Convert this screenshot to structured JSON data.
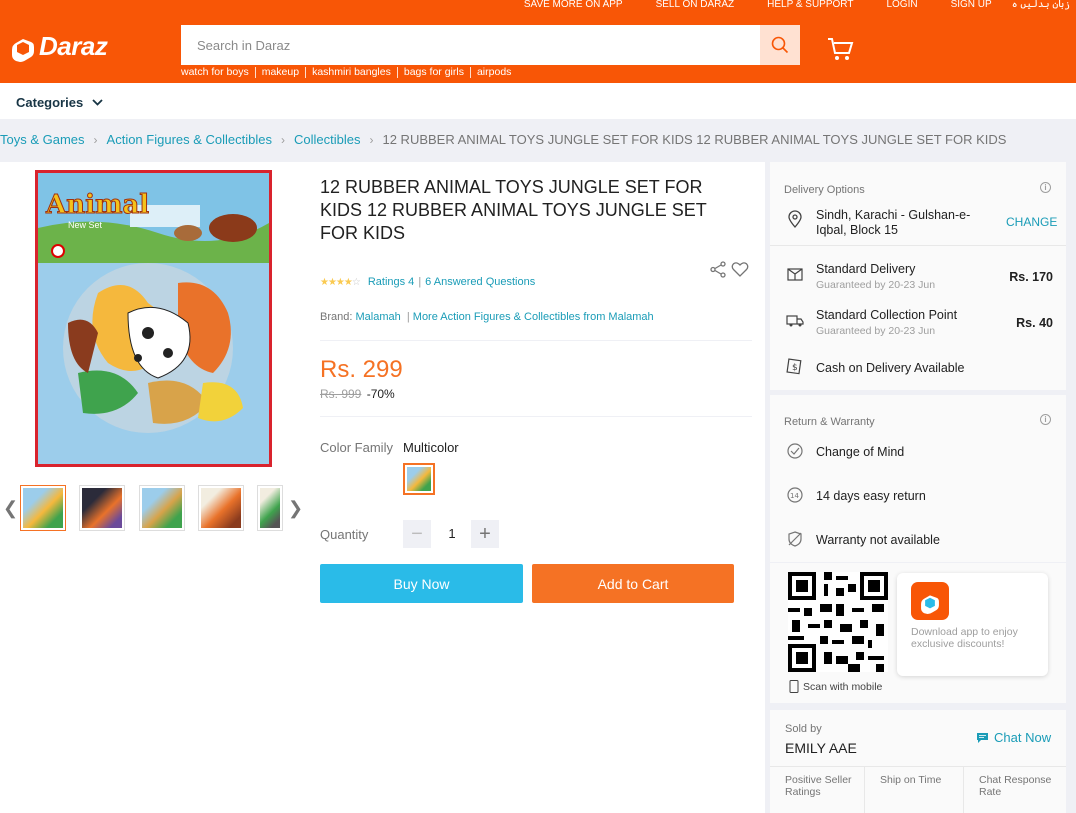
{
  "header": {
    "top_links": [
      "SAVE MORE ON APP",
      "SELL ON DARAZ",
      "HELP & SUPPORT",
      "LOGIN",
      "SIGN UP",
      "زبان بدلیں ہ"
    ],
    "logo_text": "Daraz",
    "search_placeholder": "Search in Daraz",
    "suggestions": [
      "watch for boys",
      "makeup",
      "kashmiri bangles",
      "bags for girls",
      "airpods"
    ]
  },
  "categories_label": "Categories",
  "breadcrumb": {
    "links": [
      "Toys & Games",
      "Action Figures & Collectibles",
      "Collectibles"
    ],
    "current": "12 RUBBER ANIMAL TOYS JUNGLE SET FOR KIDS 12 RUBBER ANIMAL TOYS JUNGLE SET FOR KIDS"
  },
  "product": {
    "title": "12 RUBBER ANIMAL TOYS JUNGLE SET FOR KIDS 12 RUBBER ANIMAL TOYS JUNGLE SET FOR KIDS",
    "rating_stars": 3.5,
    "ratings_text": "Ratings 4",
    "questions_text": "6 Answered Questions",
    "brand_label": "Brand:",
    "brand_name": "Malamah",
    "brand_more": "More Action Figures & Collectibles from Malamah",
    "price": "Rs. 299",
    "original_price": "Rs. 999",
    "discount": "-70%",
    "color_label": "Color Family",
    "color_value": "Multicolor",
    "quantity_label": "Quantity",
    "quantity": "1",
    "buy_now": "Buy Now",
    "add_to_cart": "Add to Cart",
    "image_pack_text": "Animal",
    "image_pack_sub": "New Set"
  },
  "delivery": {
    "title": "Delivery Options",
    "address": "Sindh, Karachi - Gulshan-e-Iqbal, Block 15",
    "change": "CHANGE",
    "options": [
      {
        "name": "Standard Delivery",
        "sub": "Guaranteed by 20-23 Jun",
        "price": "Rs. 170"
      },
      {
        "name": "Standard Collection Point",
        "sub": "Guaranteed by 20-23 Jun",
        "price": "Rs. 40"
      }
    ],
    "cod": "Cash on Delivery Available"
  },
  "warranty": {
    "title": "Return & Warranty",
    "items": [
      "Change of Mind",
      "14 days easy return",
      "Warranty not available"
    ]
  },
  "app_promo": {
    "scan_text": "Scan with mobile",
    "promo_text": "Download app to enjoy exclusive discounts!"
  },
  "seller": {
    "sold_by_label": "Sold by",
    "name": "EMILY AAE",
    "chat_label": "Chat Now",
    "metrics": [
      "Positive Seller Ratings",
      "Ship on Time",
      "Chat Response Rate"
    ]
  },
  "colors": {
    "brand": "#f85606",
    "accent": "#f57224",
    "link": "#1a9cb7",
    "buy": "#2abbe8"
  }
}
